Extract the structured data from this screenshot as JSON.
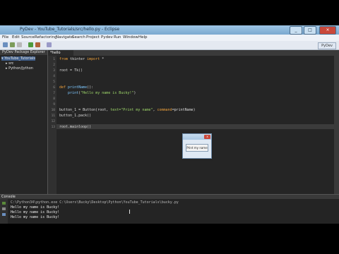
{
  "window": {
    "title": "PyDev - YouTube_Tutorials/src/hello.py - Eclipse"
  },
  "menu": [
    "File",
    "Edit",
    "Source",
    "Refactoring",
    "Navigate",
    "Search",
    "Project",
    "Pydev",
    "Run",
    "Window",
    "Help"
  ],
  "toolbar": {
    "perspective": "PyDev"
  },
  "project_explorer": {
    "tab": "PyDev Package Explorer",
    "items": [
      "YouTube_Tutorials",
      "src",
      "Python/Jython"
    ]
  },
  "editor": {
    "tab": "*hello",
    "line_numbers": [
      "1",
      "2",
      "3",
      "4",
      "5",
      "6",
      "7",
      "8",
      "9",
      "10",
      "11",
      "12",
      "13"
    ],
    "lines": [
      {
        "kw": "from",
        "rest": " tkinter ",
        "kw2": "import",
        "rest2": " *"
      },
      {
        "text": ""
      },
      {
        "text": "root = Tk()"
      },
      {
        "text": ""
      },
      {
        "text": ""
      },
      {
        "kw": "def",
        "fn": " printName",
        "rest": "():"
      },
      {
        "indent": "    ",
        "fn": "print",
        "rest": "(",
        "str": "\"Hello my name is Bucky!\"",
        "rest2": ")"
      },
      {
        "text": ""
      },
      {
        "text": ""
      },
      {
        "pre": "button_1 = Button(root, ",
        "str": "text=\"Print my name\"",
        "rest": ", ",
        "kw": "command",
        "rest2": "=printName)"
      },
      {
        "text": "button_1.pack()"
      },
      {
        "text": ""
      },
      {
        "text": "root.mainloop()"
      }
    ]
  },
  "popup": {
    "button_label": "Print my name",
    "close_label": "x"
  },
  "console": {
    "tab": "Console",
    "command": "C:\\Python34\\python.exe  C:\\Users\\Bucky\\Desktop\\Python\\YouTube_Tutorials\\bucky.py",
    "output": [
      "Hello my name is Bucky!",
      "Hello my name is Bucky!",
      "Hello my name is Bucky!"
    ]
  }
}
